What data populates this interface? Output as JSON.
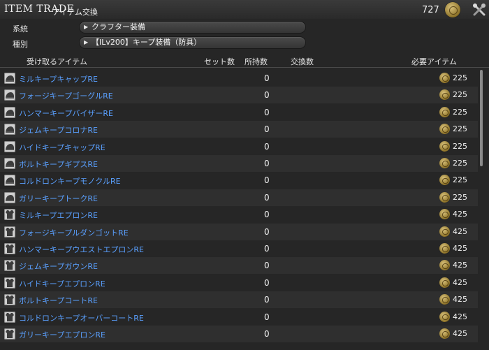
{
  "window": {
    "title": "ITEM TRADE",
    "subtitle": "アイテム交換",
    "currency_count": "727",
    "currency_icon": "scrip-icon"
  },
  "filters": [
    {
      "label": "系統",
      "value": "クラフター装備"
    },
    {
      "label": "種別",
      "value": "【ILv200】キープ装備（防具）"
    }
  ],
  "columns": {
    "item": "受け取るアイテム",
    "set_count": "セット数",
    "owned": "所持数",
    "trade_count": "交換数",
    "required": "必要アイテム"
  },
  "rows": [
    {
      "name": "ミルキープキャップRE",
      "owned": "0",
      "cost": "225",
      "icon": "head-gear-icon"
    },
    {
      "name": "フォージキープゴーグルRE",
      "owned": "0",
      "cost": "225",
      "icon": "head-gear-icon"
    },
    {
      "name": "ハンマーキープバイザーRE",
      "owned": "0",
      "cost": "225",
      "icon": "head-gear-icon"
    },
    {
      "name": "ジェムキープコロナRE",
      "owned": "0",
      "cost": "225",
      "icon": "head-gear-icon"
    },
    {
      "name": "ハイドキープキャップRE",
      "owned": "0",
      "cost": "225",
      "icon": "head-gear-icon"
    },
    {
      "name": "ボルトキープギプスRE",
      "owned": "0",
      "cost": "225",
      "icon": "head-gear-icon"
    },
    {
      "name": "コルドロンキープモノクルRE",
      "owned": "0",
      "cost": "225",
      "icon": "head-gear-icon"
    },
    {
      "name": "ガリーキープトークRE",
      "owned": "0",
      "cost": "225",
      "icon": "head-gear-icon"
    },
    {
      "name": "ミルキープエプロンRE",
      "owned": "0",
      "cost": "425",
      "icon": "body-gear-icon"
    },
    {
      "name": "フォージキープルダンゴットRE",
      "owned": "0",
      "cost": "425",
      "icon": "body-gear-icon"
    },
    {
      "name": "ハンマーキープウエストエプロンRE",
      "owned": "0",
      "cost": "425",
      "icon": "body-gear-icon"
    },
    {
      "name": "ジェムキープガウンRE",
      "owned": "0",
      "cost": "425",
      "icon": "body-gear-icon"
    },
    {
      "name": "ハイドキープエプロンRE",
      "owned": "0",
      "cost": "425",
      "icon": "body-gear-icon"
    },
    {
      "name": "ボルトキープコートRE",
      "owned": "0",
      "cost": "425",
      "icon": "body-gear-icon"
    },
    {
      "name": "コルドロンキープオーバーコートRE",
      "owned": "0",
      "cost": "425",
      "icon": "body-gear-icon"
    },
    {
      "name": "ガリーキープエプロンRE",
      "owned": "0",
      "cost": "425",
      "icon": "body-gear-icon"
    }
  ]
}
